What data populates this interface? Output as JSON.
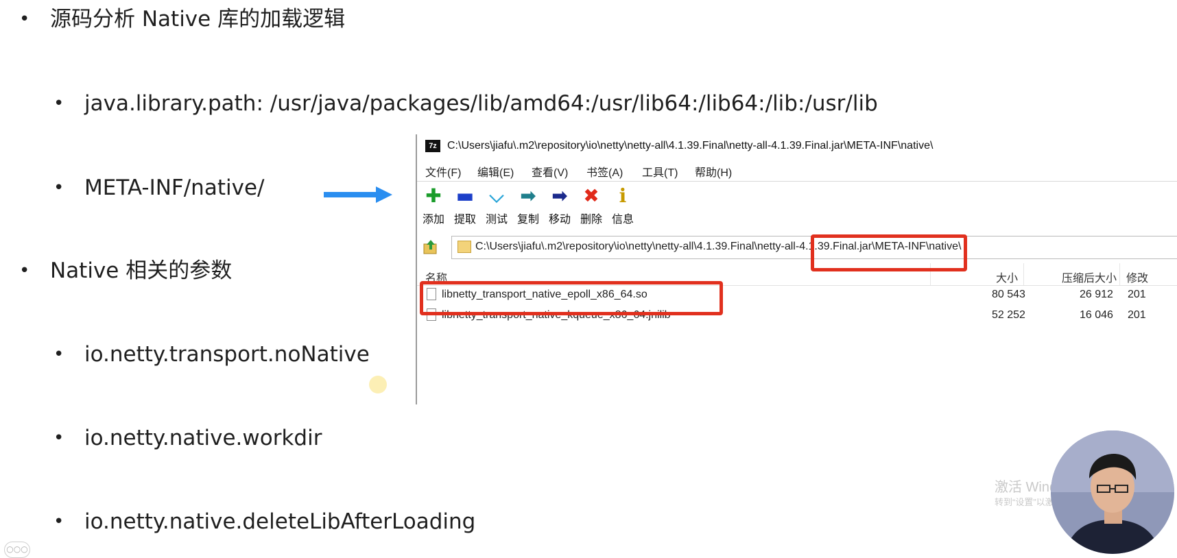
{
  "slide": {
    "bullet1": "源码分析 Native 库的加载逻辑",
    "sub1": "java.library.path: /usr/java/packages/lib/amd64:/usr/lib64:/lib64:/lib:/usr/lib",
    "sub2": "META-INF/native/",
    "bullet2": "Native 相关的参数",
    "sub3": "io.netty.transport.noNative",
    "sub4": "io.netty.native.workdir",
    "sub5": "io.netty.native.deleteLibAfterLoading",
    "bullet_glyph": "•"
  },
  "window": {
    "app_icon_label": "7z",
    "title": "C:\\Users\\jiafu\\.m2\\repository\\io\\netty\\netty-all\\4.1.39.Final\\netty-all-4.1.39.Final.jar\\META-INF\\native\\",
    "menu": [
      "文件(F)",
      "编辑(E)",
      "查看(V)",
      "书签(A)",
      "工具(T)",
      "帮助(H)"
    ],
    "toolbar": [
      {
        "label": "添加",
        "icon": "add-icon",
        "glyph": "✚",
        "color": "#1a9c2a"
      },
      {
        "label": "提取",
        "icon": "extract-icon",
        "glyph": "▬",
        "color": "#1c3fc9"
      },
      {
        "label": "测试",
        "icon": "test-icon",
        "glyph": "⌵",
        "color": "#2aa5d8"
      },
      {
        "label": "复制",
        "icon": "copy-icon",
        "glyph": "➡",
        "color": "#1f7f8c"
      },
      {
        "label": "移动",
        "icon": "move-icon",
        "glyph": "➡",
        "color": "#1b2a8c"
      },
      {
        "label": "删除",
        "icon": "delete-icon",
        "glyph": "✖",
        "color": "#e12a1a"
      },
      {
        "label": "信息",
        "icon": "info-icon",
        "glyph": "ℹ",
        "color": "#c79a00"
      }
    ],
    "address": "C:\\Users\\jiafu\\.m2\\repository\\io\\netty\\netty-all\\4.1.39.Final\\netty-all-4.1.39.Final.jar\\META-INF\\native\\",
    "columns": {
      "name": "名称",
      "size": "大小",
      "packed": "压缩后大小",
      "modified": "修改"
    },
    "files": [
      {
        "name": "libnetty_transport_native_epoll_x86_64.so",
        "size": "80 543",
        "packed": "26 912",
        "modified": "201"
      },
      {
        "name": "libnetty_transport_native_kqueue_x86_64.jnilib",
        "size": "52 252",
        "packed": "16 046",
        "modified": "201"
      }
    ]
  },
  "overlay": {
    "watermark_line1": "激活 Windows",
    "watermark_line2": "转到“设置”以激活 Windows",
    "corner_glyph": "○○○",
    "highlight_color": "#e1301e"
  }
}
